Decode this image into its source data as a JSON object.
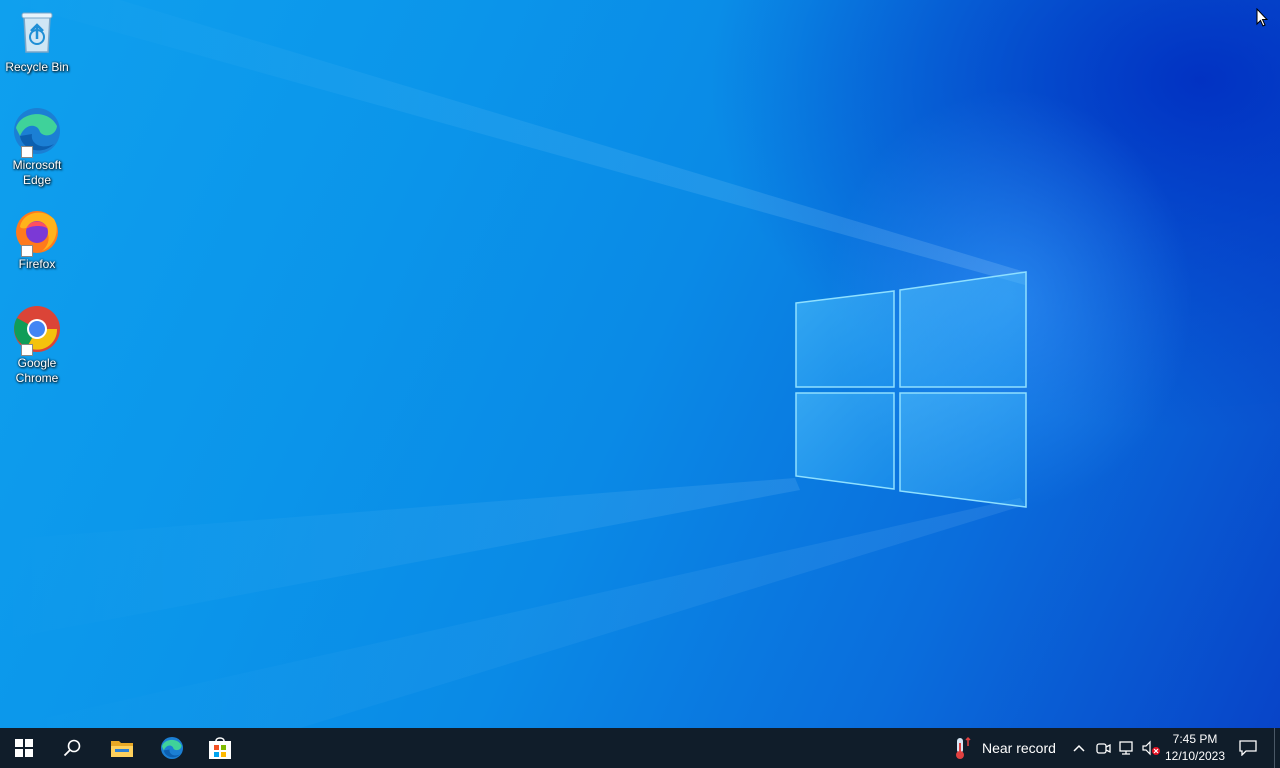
{
  "desktop": {
    "icons": [
      {
        "label": "Recycle Bin",
        "icon": "recycle-bin-icon",
        "shortcut": false
      },
      {
        "label": "Microsoft Edge",
        "icon": "edge-icon",
        "shortcut": true
      },
      {
        "label": "Firefox",
        "icon": "firefox-icon",
        "shortcut": true
      },
      {
        "label": "Google Chrome",
        "icon": "chrome-icon",
        "shortcut": true
      }
    ]
  },
  "taskbar": {
    "background": "#101d2a",
    "pinned": [
      {
        "icon": "start-windows-icon"
      },
      {
        "icon": "search-icon"
      },
      {
        "icon": "file-explorer-icon"
      },
      {
        "icon": "edge-icon"
      },
      {
        "icon": "microsoft-store-icon"
      }
    ],
    "weather": {
      "text": "Near record",
      "icon": "thermometer-icon"
    },
    "tray_icons": [
      "chevron-up-icon",
      "meet-now-icon",
      "network-icon",
      "volume-muted-icon"
    ],
    "clock": {
      "time": "7:45 PM",
      "date": "12/10/2023"
    },
    "notification_icon": "action-center-icon"
  },
  "colors": {
    "accent": "#0a6fe0",
    "wallpaper_light": "#4fc3ff"
  }
}
